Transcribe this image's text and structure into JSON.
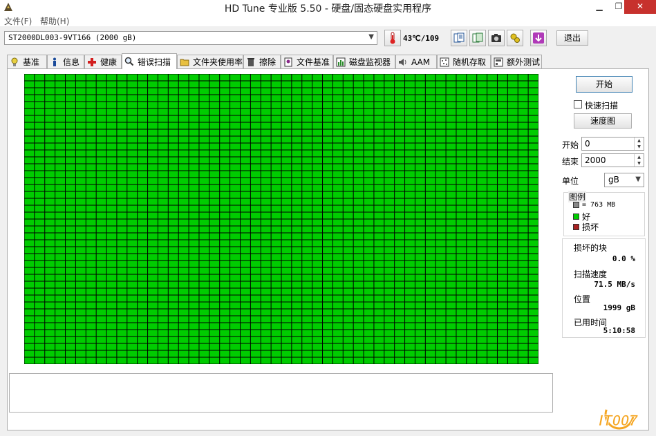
{
  "window": {
    "title": "HD Tune 专业版 5.50 - 硬盘/固态硬盘实用程序"
  },
  "menu": {
    "file": "文件(F)",
    "help": "帮助(H)"
  },
  "toolbar": {
    "drive": "ST2000DL003-9VT166 (2000 gB)",
    "temperature": "43℃/109",
    "exit_label": "退出",
    "icons": [
      "thermometer-icon",
      "copy-text-icon",
      "copy-screenshot-icon",
      "camera-icon",
      "tools-icon",
      "download-icon"
    ]
  },
  "tabs": [
    {
      "label": "基准",
      "icon": "benchmark-icon"
    },
    {
      "label": "信息",
      "icon": "info-icon"
    },
    {
      "label": "健康",
      "icon": "health-icon"
    },
    {
      "label": "错误扫描",
      "icon": "error-scan-icon",
      "active": true
    },
    {
      "label": "文件夹使用率",
      "icon": "folder-icon"
    },
    {
      "label": "擦除",
      "icon": "erase-icon"
    },
    {
      "label": "文件基准",
      "icon": "file-benchmark-icon"
    },
    {
      "label": "磁盘监视器",
      "icon": "disk-monitor-icon"
    },
    {
      "label": "AAM",
      "icon": "speaker-icon"
    },
    {
      "label": "随机存取",
      "icon": "random-access-icon"
    },
    {
      "label": "额外测试",
      "icon": "extra-tests-icon"
    }
  ],
  "scan": {
    "good_color": "#00cc00",
    "bad_color": "#aa2222",
    "block_color": "#888888"
  },
  "controls": {
    "start_button": "开始",
    "quick_scan_label": "快速扫描",
    "quick_scan_checked": false,
    "speed_map_button": "速度图",
    "start_label": "开始",
    "start_value": "0",
    "end_label": "结束",
    "end_value": "2000",
    "unit_label": "单位",
    "unit_value": "gB"
  },
  "legend": {
    "title": "图例",
    "block_size": "= 763 MB",
    "good": "好",
    "damaged": "损坏"
  },
  "stats": {
    "damaged_blocks_label": "损坏的块",
    "damaged_blocks_value": "0.0 %",
    "scan_speed_label": "扫描速度",
    "scan_speed_value": "71.5 MB/s",
    "position_label": "位置",
    "position_value": "1999 gB",
    "elapsed_label": "已用时间",
    "elapsed_value": "5:10:58"
  },
  "watermark": {
    "text": "IT007"
  }
}
